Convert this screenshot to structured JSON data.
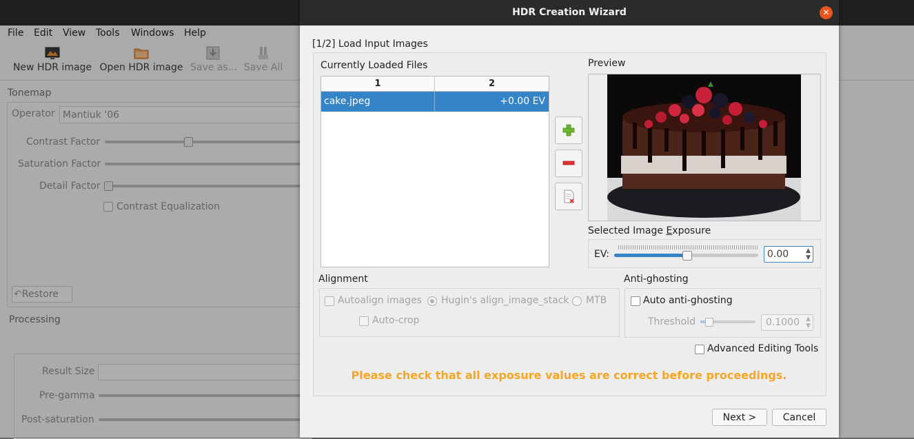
{
  "menubar": {
    "items": [
      "File",
      "Edit",
      "View",
      "Tools",
      "Windows",
      "Help"
    ]
  },
  "toolbar": {
    "new_hdr": "New HDR image",
    "open_hdr": "Open HDR image",
    "save_as": "Save as...",
    "save_all": "Save All"
  },
  "tonemap": {
    "section": "Tonemap",
    "operator_label": "Operator",
    "operator_value": "Mantiuk '06",
    "contrast_label": "Contrast Factor",
    "saturation_label": "Saturation Factor",
    "detail_label": "Detail Factor",
    "equalization_label": "Contrast Equalization",
    "restore_label": "Restore"
  },
  "processing": {
    "section": "Processing",
    "result_size_label": "Result Size",
    "pregamma_label": "Pre-gamma",
    "postsat_label": "Post-saturation"
  },
  "dialog": {
    "title": "HDR Creation Wizard",
    "close_glyph": "✕",
    "step": "[1/2] Load Input Images",
    "files_label": "Currently Loaded Files",
    "table": {
      "columns": [
        "1",
        "2"
      ],
      "rows": [
        {
          "file": "cake.jpeg",
          "ev": "+0.00 EV"
        }
      ]
    },
    "preview_label": "Preview",
    "exposure_label": "Selected Image Exposure",
    "ev_label": "EV:",
    "ev_value": "0.00",
    "ev_slider_level": 0.5,
    "alignment": {
      "label": "Alignment",
      "autoalign": "Autoalign images",
      "hugin": "Hugin's align_image_stack",
      "mtb": "MTB",
      "autocrop": "Auto-crop"
    },
    "antighosting": {
      "label": "Anti-ghosting",
      "auto": "Auto anti-ghosting",
      "threshold_label": "Threshold",
      "threshold_value": "0.1000"
    },
    "advanced_label": "Advanced Editing Tools",
    "warning": "Please check that all exposure values are correct before proceedings.",
    "next_label": "Next >",
    "cancel_label": "Cancel"
  },
  "colors": {
    "selection": "#3584c8",
    "warning": "#f5a623",
    "close": "#e9541f",
    "add": "#6cb52d",
    "remove": "#e0312f"
  }
}
